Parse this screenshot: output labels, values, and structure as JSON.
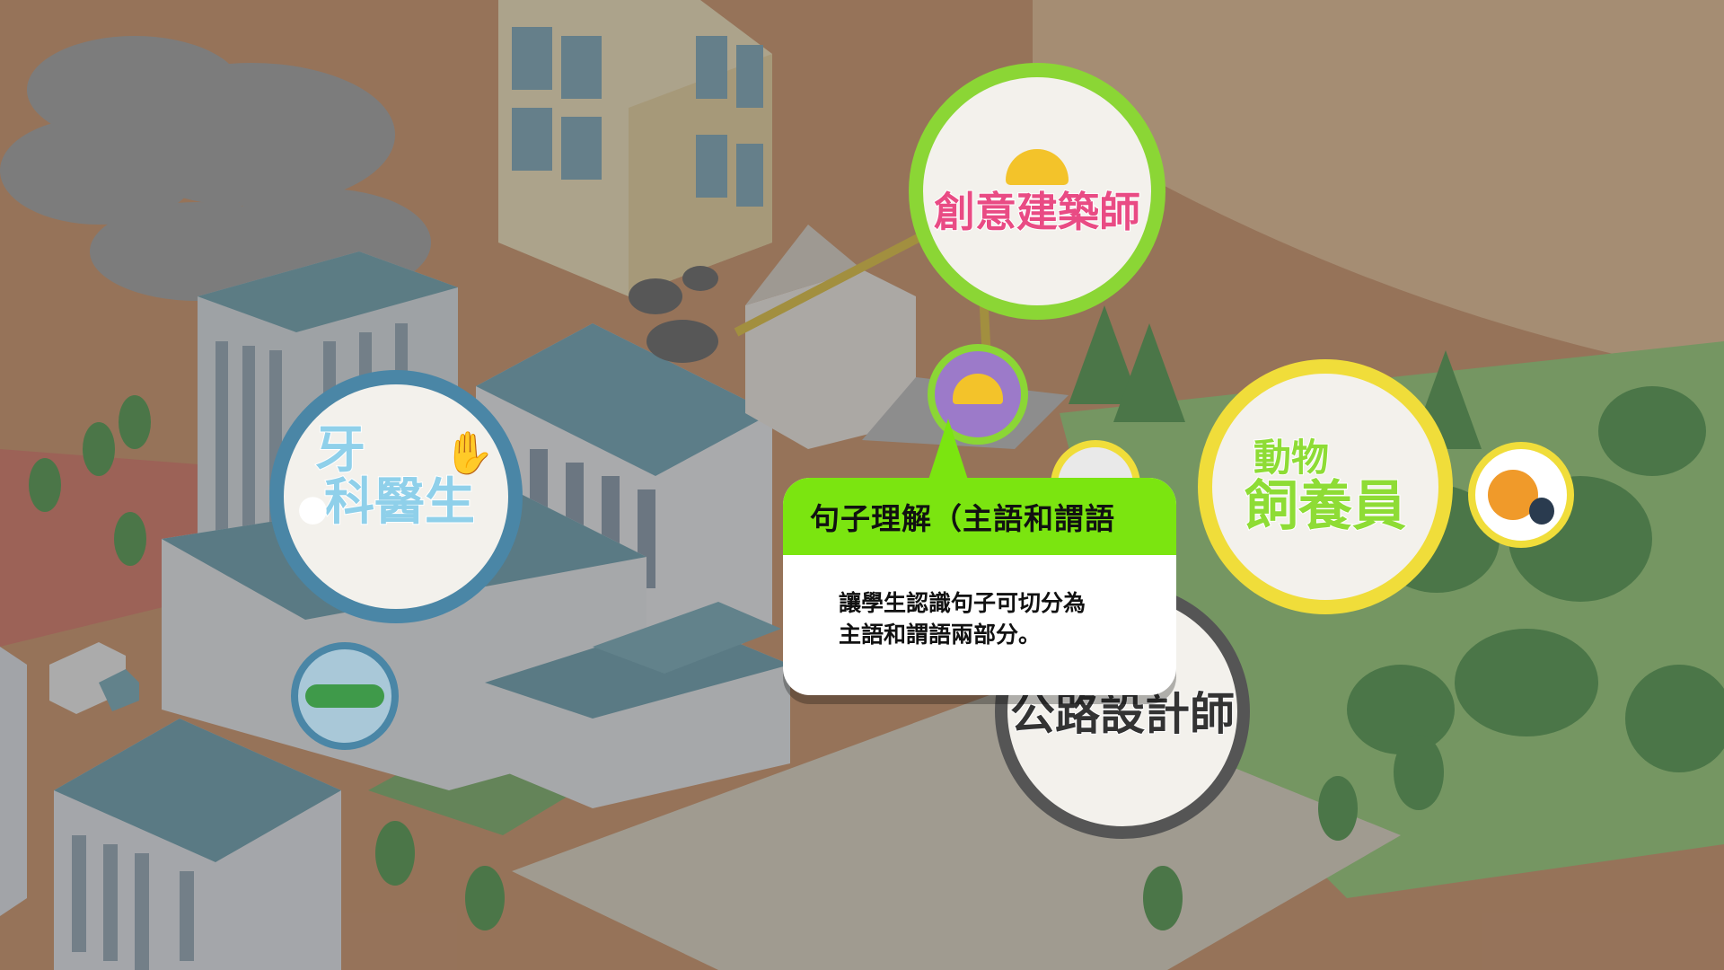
{
  "game_map": {
    "badges": [
      {
        "id": "dentist",
        "label_line1": "牙",
        "label_line2": "科醫生",
        "ring_color": "#4a86a6",
        "text_color": "#8fd0ea"
      },
      {
        "id": "architect",
        "label": "創意建築師",
        "ring_color": "#8bd635",
        "text_color": "#e94b84"
      },
      {
        "id": "zookeeper",
        "label_line1": "動物",
        "label_line2": "飼養員",
        "ring_color": "#f0dd3a",
        "text_color": "#8edc35"
      },
      {
        "id": "road_designer",
        "label": "公路設計師",
        "ring_color": "#555555",
        "text_color": "#333333"
      }
    ],
    "level_markers": [
      {
        "id": "architect-level",
        "icon": "hardhat-character-icon",
        "ring_color": "#8bd635"
      },
      {
        "id": "dentist-level",
        "icon": "crocodile-icon",
        "ring_color": "#4a86a6"
      },
      {
        "id": "zookeeper-level",
        "icon": "lion-penguin-icon",
        "ring_color": "#f0dd3a"
      }
    ]
  },
  "tooltip": {
    "title": "句子理解（主語和謂語",
    "description_line1": "讓學生認識句子可切分為",
    "description_line2": "主語和謂語兩部分。",
    "header_color": "#7be510"
  }
}
